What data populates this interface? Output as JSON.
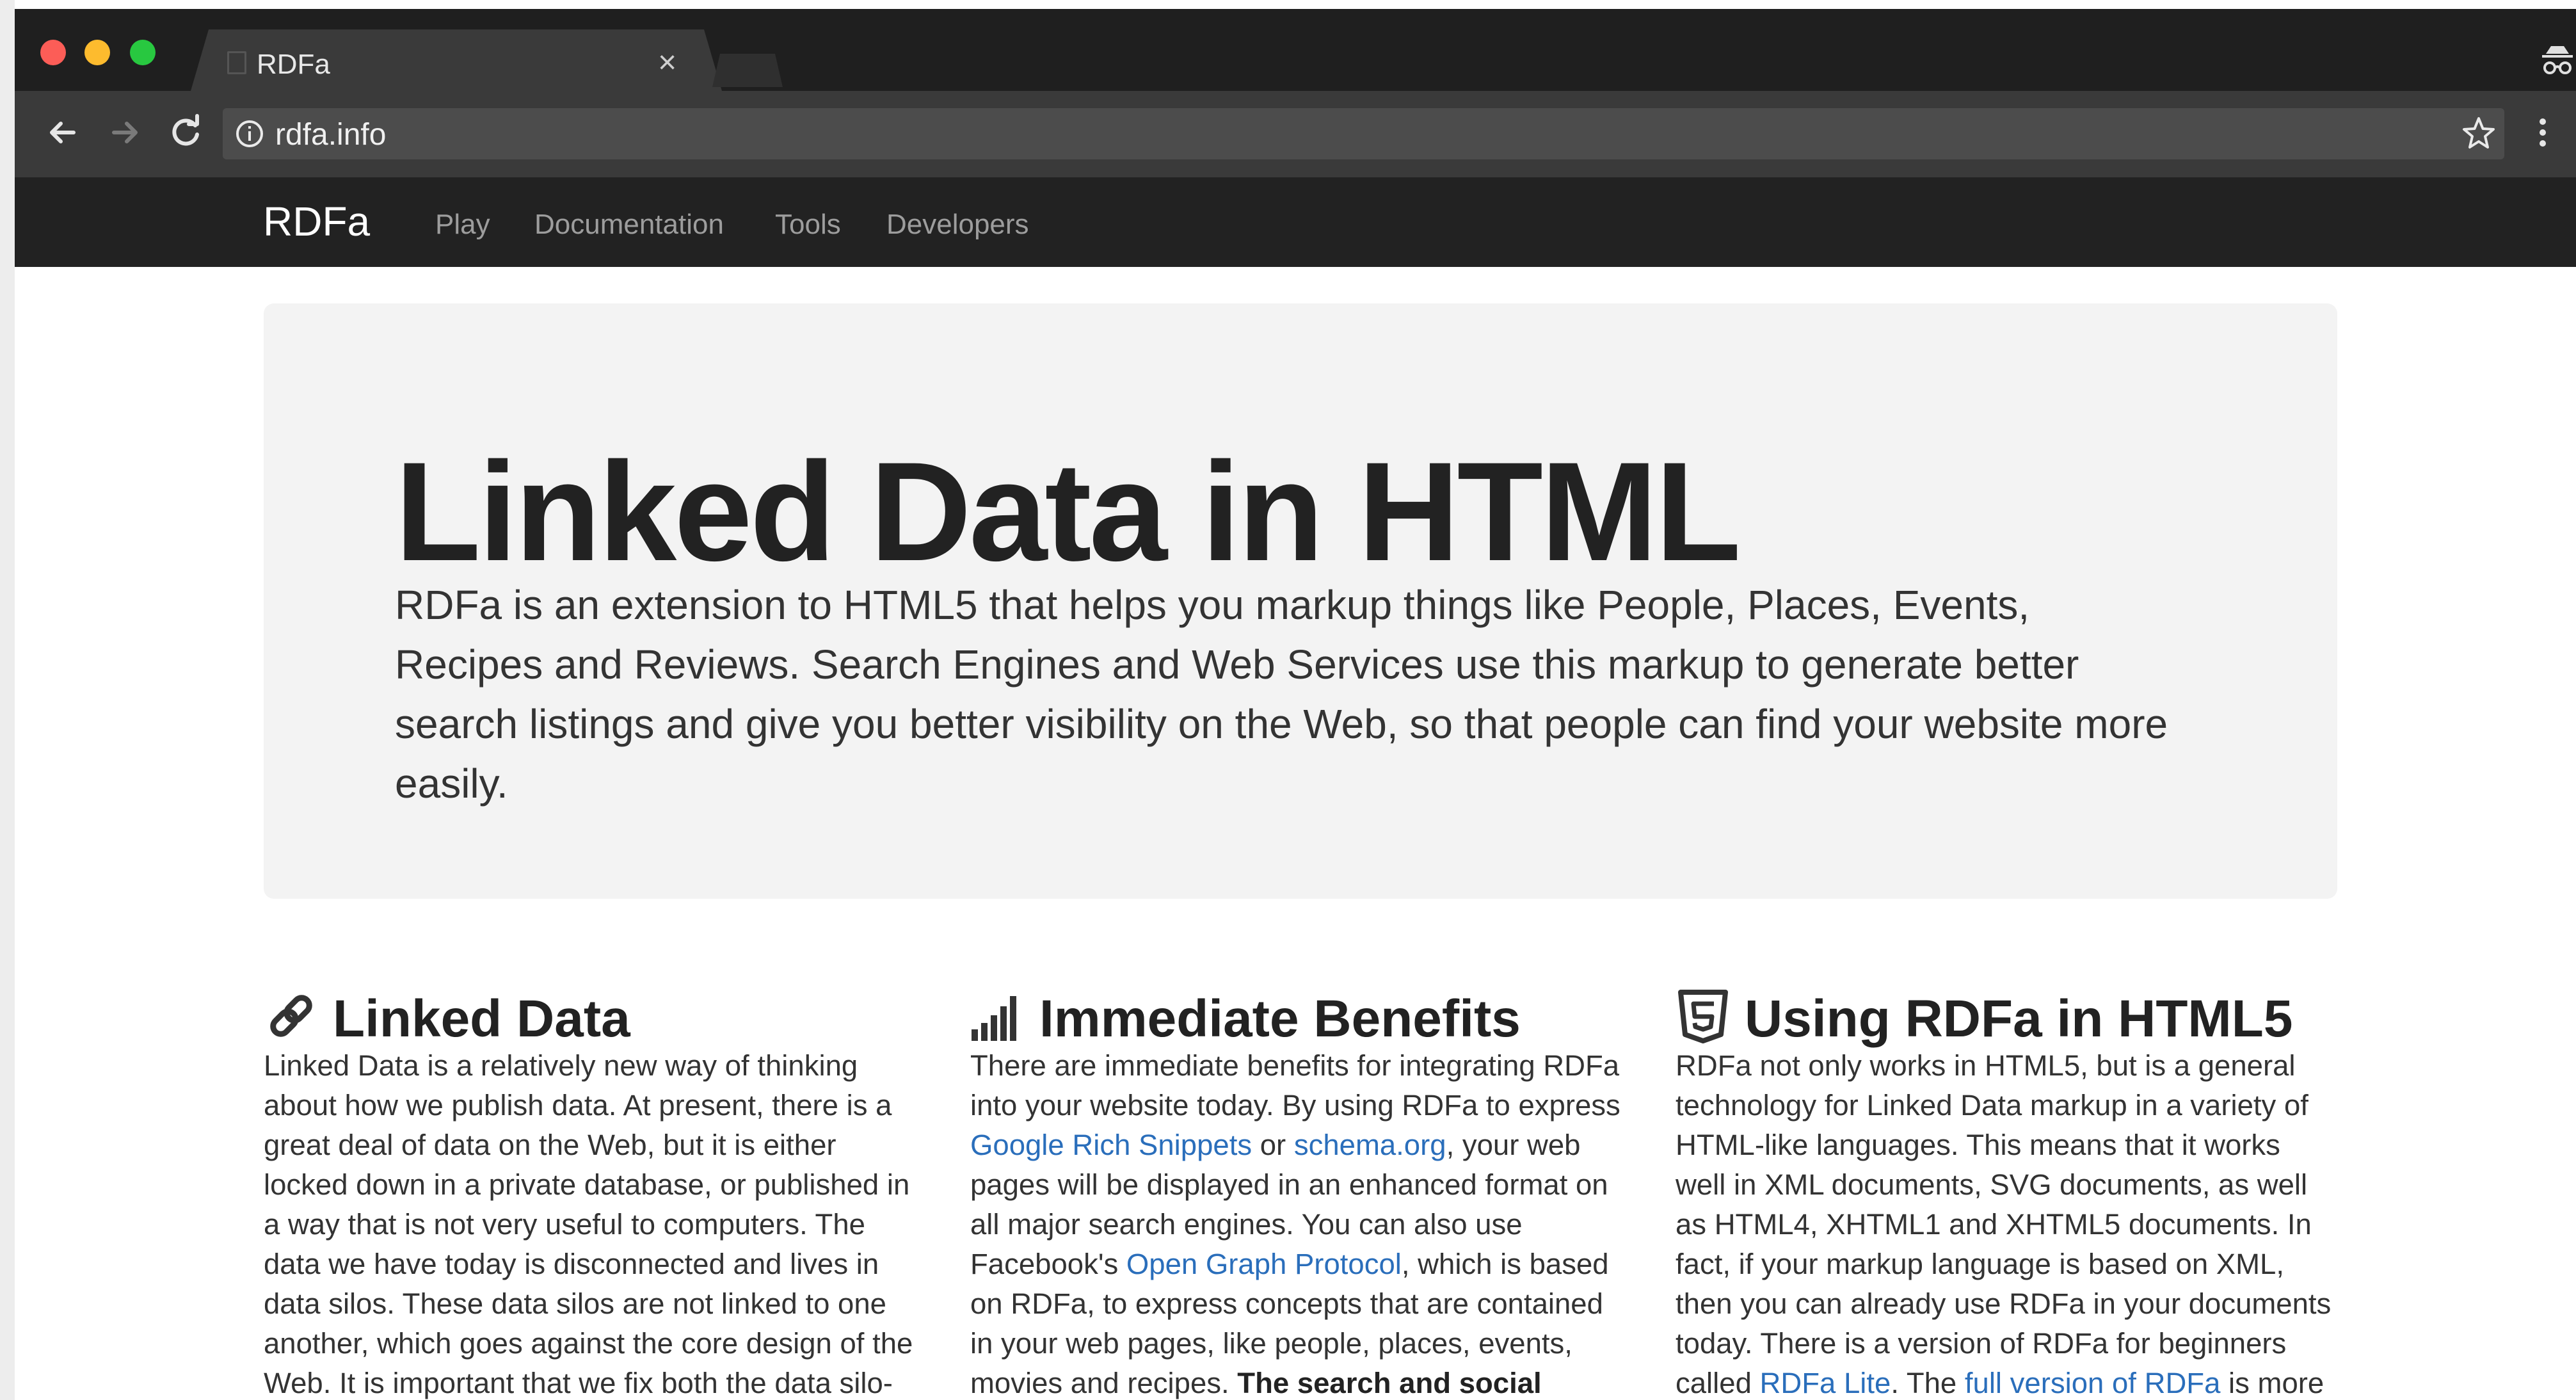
{
  "browser": {
    "tab_title": "RDFa",
    "tab_close": "×",
    "url": "rdfa.info"
  },
  "navbar": {
    "brand": "RDFa",
    "links": [
      "Play",
      "Documentation",
      "Tools",
      "Developers"
    ]
  },
  "hero": {
    "title": "Linked Data in HTML",
    "lead": "RDFa is an extension to HTML5 that helps you markup things like People, Places, Events, Recipes and Reviews. Search Engines and Web Services use this markup to generate better search listings and give you better visibility on the Web, so that people can find your website more easily."
  },
  "columns": {
    "linked_data": {
      "icon": "link-icon",
      "title": "Linked Data",
      "text": "Linked Data is a relatively new way of thinking about how we publish data. At present, there is a great deal of data on the Web, but it is either locked down in a private database, or published in a way that is not very useful to computers. The data we have today is disconnected and lives in data silos. These data silos are not linked to one another, which goes against the core design of the Web. It is important that we fix both the data silo-"
    },
    "benefits": {
      "icon": "signal-bars-icon",
      "title": "Immediate Benefits",
      "text_1": "There are immediate benefits for integrating RDFa into your website today. By using RDFa to express ",
      "link_1": "Google Rich Snippets",
      "text_2": " or ",
      "link_2": "schema.org",
      "text_3": ", your web pages will be displayed in an enhanced format on all major search engines. You can also use Facebook's ",
      "link_3": "Open Graph Protocol",
      "text_4": ", which is based on RDFa, to express concepts that are contained in your web pages, like people, places, events, movies and recipes. ",
      "bold_1": "The search and social"
    },
    "html5": {
      "icon": "html5-icon",
      "title": "Using RDFa in HTML5",
      "text_1": "RDFa not only works in HTML5, but is a general technology for Linked Data markup in a variety of HTML-like languages. This means that it works well in XML documents, SVG documents, as well as HTML4, XHTML1 and XHTML5 documents. In fact, if your markup language is based on XML, then you can already use RDFa in your documents today. There is a version of RDFa for beginners called ",
      "link_1": "RDFa Lite",
      "text_2": ". The ",
      "link_2": "full version of RDFa",
      "text_3": " is more"
    }
  },
  "colors": {
    "navbar_bg": "#222222",
    "link": "#2a6ebb",
    "jumbotron_bg": "#f3f3f3"
  }
}
